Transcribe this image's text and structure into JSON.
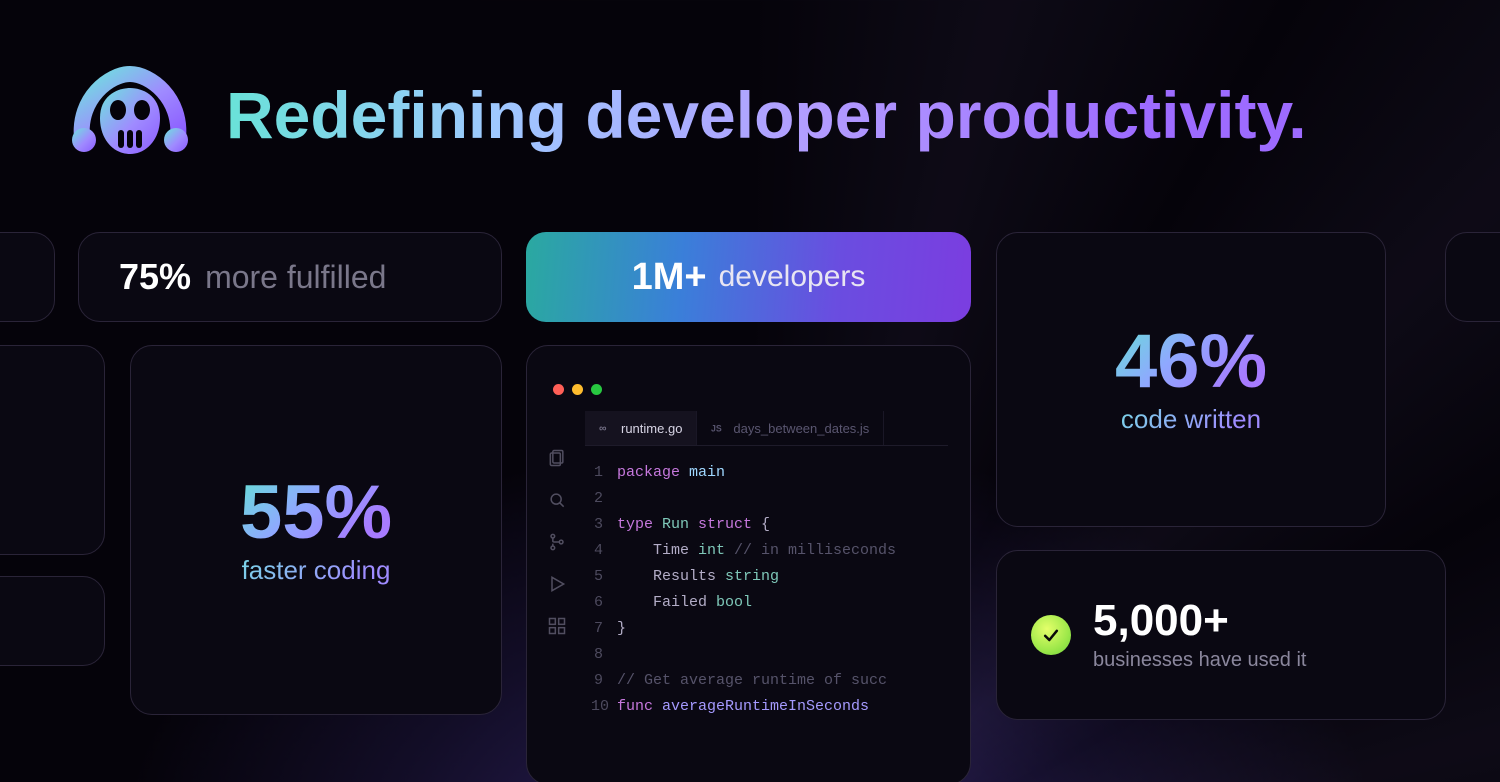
{
  "hero": {
    "headline": "Redefining developer productivity.",
    "logo_name": "copilot-logo"
  },
  "stats": {
    "fulfilled": {
      "figure": "75%",
      "label": "more fulfilled"
    },
    "faster_coding": {
      "figure": "55%",
      "label": "faster coding"
    },
    "developers": {
      "figure": "1M+",
      "label": "developers"
    },
    "code_written": {
      "figure": "46%",
      "label": "code written"
    },
    "businesses": {
      "figure": "5,000+",
      "label": "businesses have used it"
    }
  },
  "editor": {
    "activity_icons": [
      "files-icon",
      "search-icon",
      "source-control-icon",
      "run-debug-icon",
      "extensions-icon"
    ],
    "tabs": [
      {
        "icon": "go-file-icon",
        "label": "runtime.go",
        "active": true
      },
      {
        "icon": "js-file-icon",
        "label": "days_between_dates.js",
        "active": false
      }
    ],
    "code_lines": [
      {
        "n": 1,
        "segments": [
          [
            "kw",
            "package "
          ],
          [
            "ident",
            "main"
          ]
        ]
      },
      {
        "n": 2,
        "segments": []
      },
      {
        "n": 3,
        "segments": [
          [
            "kw",
            "type "
          ],
          [
            "typ",
            "Run"
          ],
          [
            "kw",
            " struct "
          ],
          [
            "",
            "{"
          ]
        ]
      },
      {
        "n": 4,
        "segments": [
          [
            "",
            "    Time "
          ],
          [
            "typ",
            "int"
          ],
          [
            "code-comment",
            " // in milliseconds"
          ]
        ]
      },
      {
        "n": 5,
        "segments": [
          [
            "",
            "    Results "
          ],
          [
            "typ",
            "string"
          ]
        ]
      },
      {
        "n": 6,
        "segments": [
          [
            "",
            "    Failed "
          ],
          [
            "typ",
            "bool"
          ]
        ]
      },
      {
        "n": 7,
        "segments": [
          [
            "",
            "}"
          ]
        ]
      },
      {
        "n": 8,
        "segments": []
      },
      {
        "n": 9,
        "segments": [
          [
            "code-comment",
            "// Get average runtime of succ"
          ]
        ]
      },
      {
        "n": 10,
        "segments": [
          [
            "kw",
            "func "
          ],
          [
            "fn",
            "averageRuntimeInSeconds"
          ]
        ]
      }
    ]
  }
}
